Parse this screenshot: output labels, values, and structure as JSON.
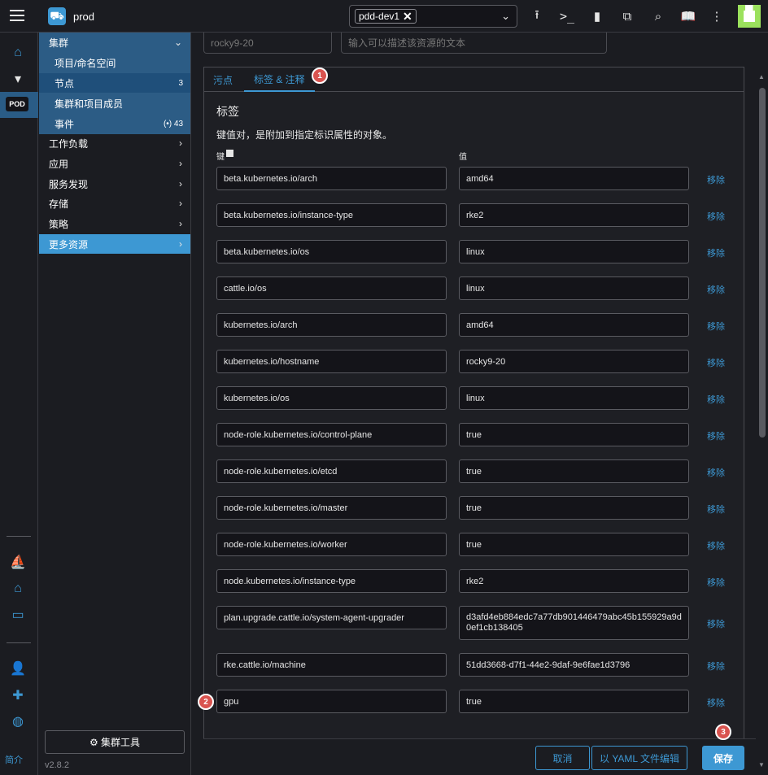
{
  "header": {
    "cluster_name": "prod",
    "namespace_chip": "pdd-dev1",
    "icons": [
      "upload-icon",
      "terminal-icon",
      "file-icon",
      "copy-icon",
      "search-icon",
      "book-icon",
      "more-vert-icon"
    ]
  },
  "rail": {
    "pod_badge": "POD",
    "about_label": "简介"
  },
  "nav": {
    "cluster_group": "集群",
    "items": [
      {
        "label": "项目/命名空间"
      },
      {
        "label": "节点",
        "count": "3"
      },
      {
        "label": "集群和项目成员"
      },
      {
        "label": "事件",
        "count": "(•) 43"
      }
    ],
    "groups": [
      "工作负载",
      "应用",
      "服务发现",
      "存储",
      "策略",
      "更多资源"
    ],
    "cluster_tools": "⚙ 集群工具",
    "version": "v2.8.2"
  },
  "form": {
    "name_value": "rocky9-20",
    "description_placeholder": "输入可以描述该资源的文本"
  },
  "tabs": [
    {
      "label": "污点"
    },
    {
      "label": "标签 & 注释",
      "active": true
    }
  ],
  "labels_section": {
    "title": "标签",
    "description": "键值对，是附加到指定标识属性的对象。",
    "key_header": "键",
    "value_header": "值",
    "remove_label": "移除",
    "rows": [
      {
        "key": "beta.kubernetes.io/arch",
        "value": "amd64"
      },
      {
        "key": "beta.kubernetes.io/instance-type",
        "value": "rke2"
      },
      {
        "key": "beta.kubernetes.io/os",
        "value": "linux"
      },
      {
        "key": "cattle.io/os",
        "value": "linux"
      },
      {
        "key": "kubernetes.io/arch",
        "value": "amd64"
      },
      {
        "key": "kubernetes.io/hostname",
        "value": "rocky9-20"
      },
      {
        "key": "kubernetes.io/os",
        "value": "linux"
      },
      {
        "key": "node-role.kubernetes.io/control-plane",
        "value": "true"
      },
      {
        "key": "node-role.kubernetes.io/etcd",
        "value": "true"
      },
      {
        "key": "node-role.kubernetes.io/master",
        "value": "true"
      },
      {
        "key": "node-role.kubernetes.io/worker",
        "value": "true"
      },
      {
        "key": "node.kubernetes.io/instance-type",
        "value": "rke2"
      },
      {
        "key": "plan.upgrade.cattle.io/system-agent-upgrader",
        "value": "d3afd4eb884edc7a77db901446479abc45b155929a9d0ef1cb138405"
      },
      {
        "key": "rke.cattle.io/machine",
        "value": "51dd3668-d7f1-44e2-9daf-9e6fae1d3796"
      },
      {
        "key": "gpu",
        "value": "true"
      }
    ]
  },
  "footer": {
    "cancel": "取消",
    "edit_yaml": "以 YAML 文件编辑",
    "save": "保存"
  },
  "markers": [
    "1",
    "2",
    "3"
  ],
  "colors": {
    "accent": "#3d98d3",
    "marker": "#d9534f",
    "background": "#1b1c21"
  }
}
